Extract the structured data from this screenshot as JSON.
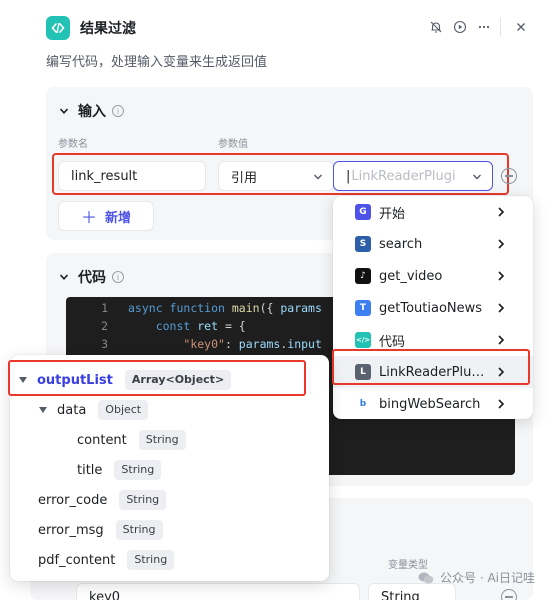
{
  "header": {
    "title": "结果过滤",
    "description": "编写代码，处理输入变量来生成返回值"
  },
  "input_section": {
    "title": "输入",
    "info": "i",
    "col_param_name": "参数名",
    "col_param_value": "参数值",
    "row": {
      "name_value": "link_result",
      "ref_type": "引用",
      "ref_placeholder": "LinkReaderPlugi"
    },
    "add_label": "新增"
  },
  "code_section": {
    "title": "代码",
    "info": "i",
    "lines": [
      {
        "num": "1",
        "parts": [
          [
            "kw",
            "async "
          ],
          [
            "kw",
            "function "
          ],
          [
            "fn",
            "main"
          ],
          [
            "pun",
            "({ "
          ],
          [
            "var",
            "params"
          ]
        ]
      },
      {
        "num": "2",
        "parts": [
          [
            "pun",
            "    "
          ],
          [
            "kw",
            "const "
          ],
          [
            "var",
            "ret"
          ],
          [
            "pun",
            " = {"
          ]
        ]
      },
      {
        "num": "3",
        "parts": [
          [
            "pun",
            "        "
          ],
          [
            "str",
            "\"key0\""
          ],
          [
            "pun",
            ": "
          ],
          [
            "var",
            "params"
          ],
          [
            "pun",
            "."
          ],
          [
            "var",
            "input"
          ]
        ]
      }
    ]
  },
  "output_section": {
    "col_var_type": "变量类型",
    "row": {
      "name_value": "key0",
      "type_value": "String"
    }
  },
  "ref_menu": {
    "items": [
      {
        "label": "开始",
        "icon": "start-icon",
        "color": "#4d53e8",
        "glyph": "G"
      },
      {
        "label": "search",
        "icon": "search-plugin-icon",
        "color": "#2d5fa8",
        "glyph": "S"
      },
      {
        "label": "get_video",
        "icon": "tiktok-icon",
        "color": "#111111",
        "glyph": "♪"
      },
      {
        "label": "getToutiaoNews",
        "icon": "toutiao-icon",
        "color": "#3d7ef0",
        "glyph": "T"
      },
      {
        "label": "代码",
        "icon": "code-icon",
        "color": "#22c3b4",
        "glyph": "</>"
      },
      {
        "label": "LinkReaderPlu…",
        "icon": "link-reader-icon",
        "color": "#5a6270",
        "glyph": "L"
      },
      {
        "label": "bingWebSearch",
        "icon": "bing-icon",
        "color": "#ffffff",
        "glyph": "b"
      }
    ]
  },
  "output_tree": {
    "rows": [
      {
        "label": "outputList",
        "type": "Array<Object>",
        "indent": 0,
        "expandable": true
      },
      {
        "label": "data",
        "type": "Object",
        "indent": 1,
        "expandable": true
      },
      {
        "label": "content",
        "type": "String",
        "indent": 2,
        "expandable": false
      },
      {
        "label": "title",
        "type": "String",
        "indent": 2,
        "expandable": false
      },
      {
        "label": "error_code",
        "type": "String",
        "indent": 1,
        "expandable": false
      },
      {
        "label": "error_msg",
        "type": "String",
        "indent": 1,
        "expandable": false
      },
      {
        "label": "pdf_content",
        "type": "String",
        "indent": 1,
        "expandable": false
      }
    ]
  },
  "watermark": {
    "text": "公众号 · Ai日记哇"
  },
  "colors": {
    "primary": "#4d53e8",
    "highlight": "#e8382b",
    "code_bg": "#1e1e1e"
  }
}
